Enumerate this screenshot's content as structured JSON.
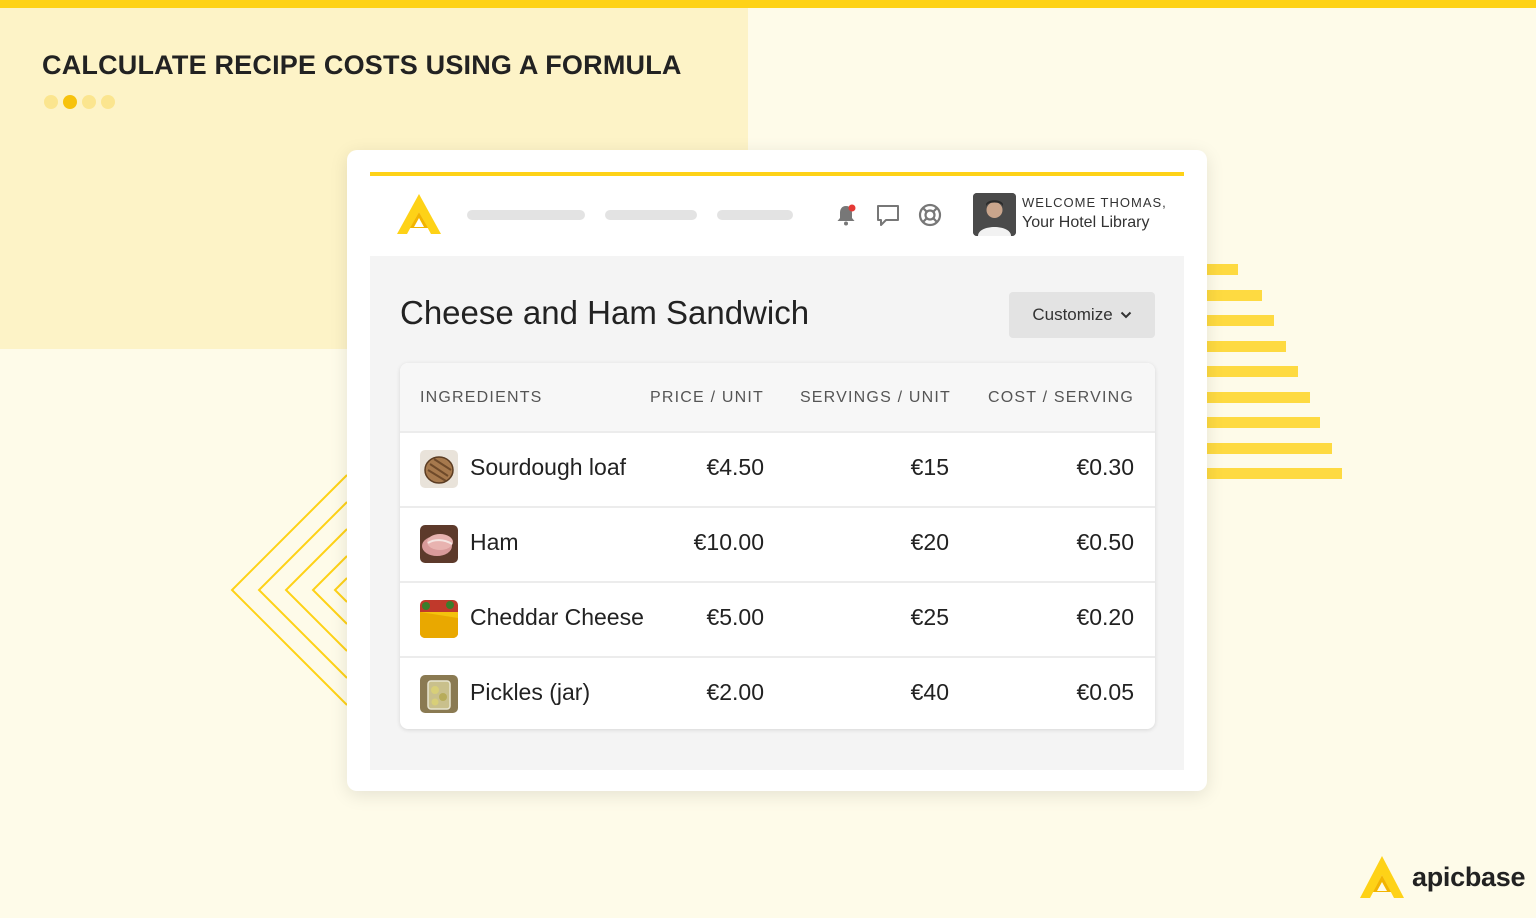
{
  "headline": {
    "title": "CALCULATE RECIPE COSTS USING A FORMULA",
    "dots_total": 4,
    "dots_active_index": 1
  },
  "colors": {
    "accent_yellow": "#fed217",
    "background": "#fefbe9",
    "panel_yellow": "#fdf3c7",
    "notification_dot": "#e53935"
  },
  "app": {
    "logo_icon": "apicbase-a-logo-icon",
    "nav_icons": [
      "bell-icon",
      "chat-icon",
      "help-lifebuoy-icon"
    ],
    "user": {
      "welcome": "WELCOME THOMAS,",
      "org": "Your Hotel Library",
      "avatar_icon": "avatar"
    }
  },
  "recipe": {
    "title": "Cheese and Ham Sandwich",
    "customize_label": "Customize"
  },
  "table": {
    "headers": [
      "INGREDIENTS",
      "PRICE / UNIT",
      "SERVINGS / UNIT",
      "COST / SERVING"
    ],
    "rows": [
      {
        "name": "Sourdough loaf",
        "price": "€4.50",
        "servings": "€15",
        "cost": "€0.30",
        "thumb": "bread-thumbnail"
      },
      {
        "name": "Ham",
        "price": "€10.00",
        "servings": "€20",
        "cost": "€0.50",
        "thumb": "ham-thumbnail"
      },
      {
        "name": "Cheddar Cheese",
        "price": "€5.00",
        "servings": "€25",
        "cost": "€0.20",
        "thumb": "cheese-thumbnail"
      },
      {
        "name": "Pickles (jar)",
        "price": "€2.00",
        "servings": "€40",
        "cost": "€0.05",
        "thumb": "pickles-thumbnail"
      }
    ]
  },
  "brand": {
    "name": "apicbase"
  }
}
